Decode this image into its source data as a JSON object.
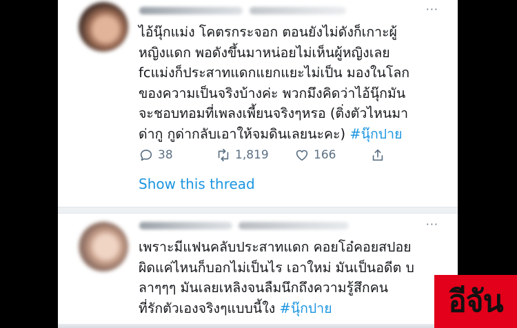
{
  "tweet1": {
    "lines": [
      "ไอ้นุ๊กแม่ง โคตรกระจอก ตอนยังไม่ดังก็เกาะผู้",
      "หญิงแดก พอดังขึ้นมาหน่อยไม่เห็นผู้หญิงเลย",
      "fcแม่งก็ประสาทแดกแยกแยะไม่เป็น มองในโลก",
      "ของความเป็นจริงบ้างค่ะ พวกมึงคิดว่าไอ้นุ๊กมัน",
      "จะชอบทอมที่เพลงเพี้ยนจริงๆหรอ (ติ่งตัวไหนมา"
    ],
    "last_line_text": "ด่ากู กูด่ากลับเอาให้จมดินเลยนะคะ) ",
    "hashtag": "#นุ๊กปาย",
    "replies": "38",
    "retweets": "1,819",
    "likes": "166",
    "show_thread": "Show this thread",
    "more_icon": "···"
  },
  "tweet2": {
    "lines": [
      "เพราะมีแฟนคลับประสาทแดก คอยโอ๋คอยสปอย",
      "ผิดแค่ไหนก็บอกไม่เป็นไร เอาใหม่ มันเป็นอดีต บ",
      "ลาๆๆๆ มันเลยเหลิงจนลืมนึกถึงความรู้สึกคน"
    ],
    "last_line_text": "ที่รักตัวเองจริงๆแบบนี้ใง ",
    "hashtag": "#นุ๊กปาย",
    "more_icon": "···"
  },
  "logo": {
    "text": "อีจัน"
  },
  "colors": {
    "link": "#1b95e0",
    "text": "#14171a",
    "muted": "#5b7083",
    "logo_bg": "#e2001a"
  }
}
